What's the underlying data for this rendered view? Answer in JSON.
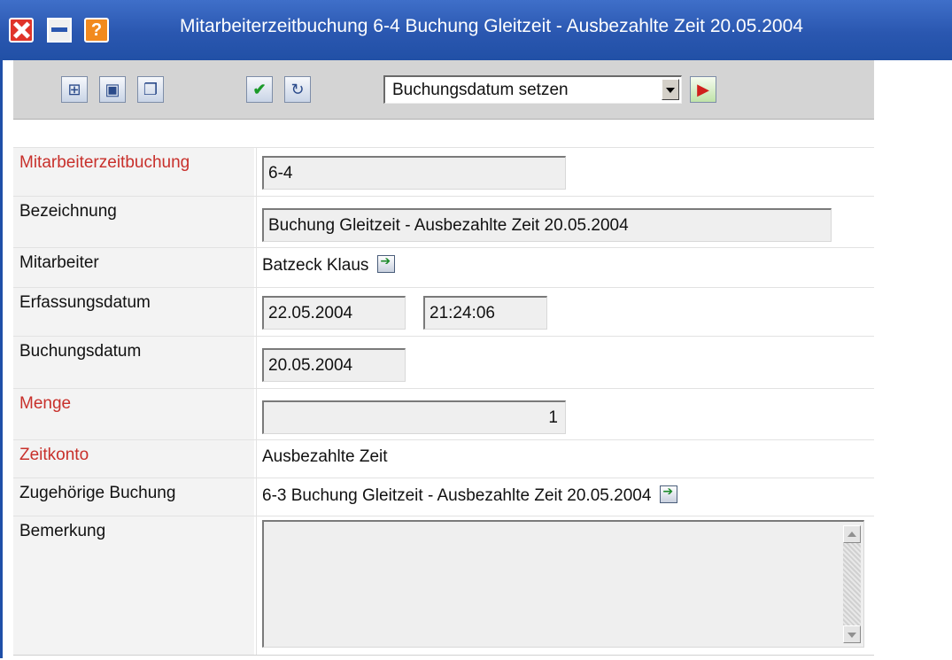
{
  "window": {
    "title": "Mitarbeiterzeitbuchung 6-4 Buchung Gleitzeit - Ausbezahlte Zeit 20.05.2004"
  },
  "toolbar": {
    "action_select_value": "Buchungsdatum setzen"
  },
  "form": {
    "mitarbeiterzeitbuchung": {
      "label": "Mitarbeiterzeitbuchung",
      "value": "6-4"
    },
    "bezeichnung": {
      "label": "Bezeichnung",
      "value": "Buchung Gleitzeit - Ausbezahlte Zeit 20.05.2004"
    },
    "mitarbeiter": {
      "label": "Mitarbeiter",
      "value": "Batzeck Klaus"
    },
    "erfassungsdatum": {
      "label": "Erfassungsdatum",
      "date": "22.05.2004",
      "time": "21:24:06"
    },
    "buchungsdatum": {
      "label": "Buchungsdatum",
      "value": "20.05.2004"
    },
    "menge": {
      "label": "Menge",
      "value": "1"
    },
    "zeitkonto": {
      "label": "Zeitkonto",
      "value": "Ausbezahlte Zeit"
    },
    "zugehoerige_buchung": {
      "label": "Zugehörige Buchung",
      "value": "6-3 Buchung Gleitzeit - Ausbezahlte Zeit 20.05.2004"
    },
    "bemerkung": {
      "label": "Bemerkung",
      "value": ""
    }
  },
  "colors": {
    "titlebar": "#2a57b0",
    "required_label": "#c8302b",
    "toolbar_bg": "#d4d4d4"
  }
}
